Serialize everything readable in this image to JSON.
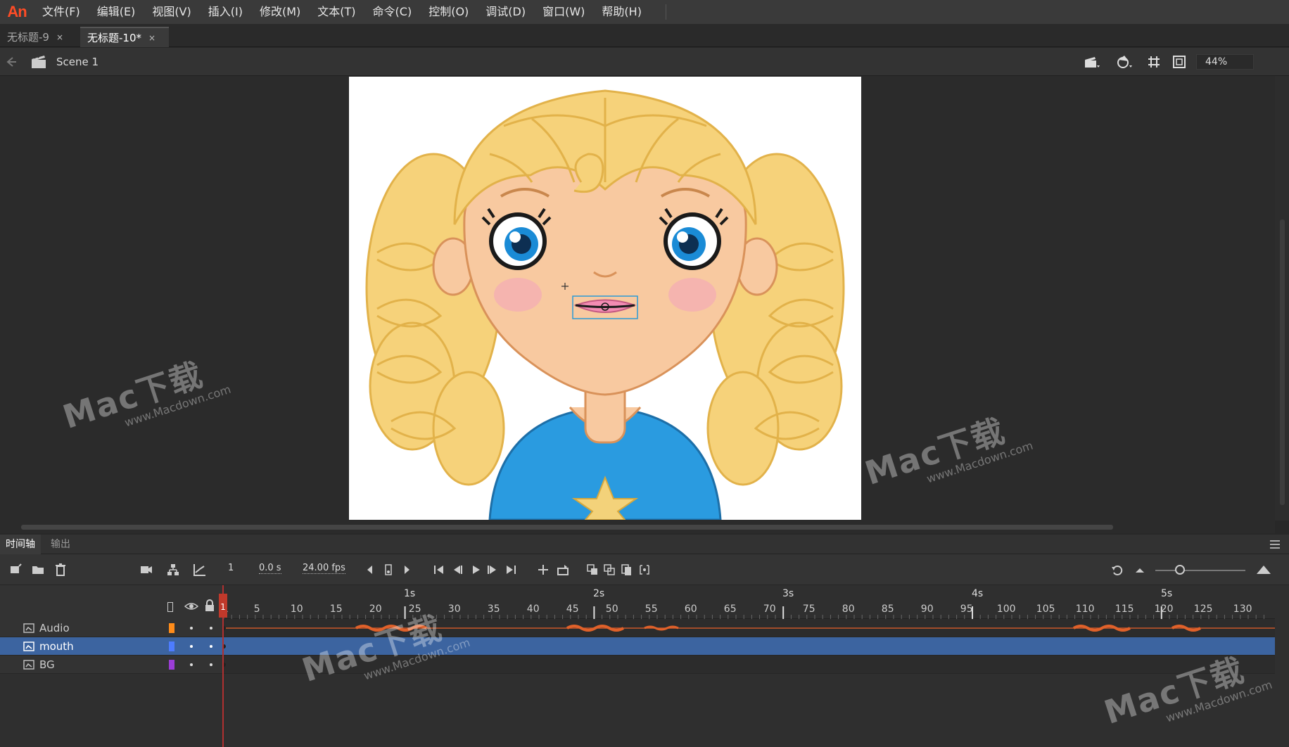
{
  "app": {
    "logo": "An"
  },
  "menu": {
    "items": [
      "文件(F)",
      "编辑(E)",
      "视图(V)",
      "插入(I)",
      "修改(M)",
      "文本(T)",
      "命令(C)",
      "控制(O)",
      "调试(D)",
      "窗口(W)",
      "帮助(H)"
    ]
  },
  "tabs": [
    {
      "label": "无标题-9",
      "close": "×",
      "active": false
    },
    {
      "label": "无标题-10*",
      "close": "×",
      "active": true
    }
  ],
  "editbar": {
    "scene": "Scene 1",
    "zoom": "44%"
  },
  "panel_tabs": {
    "timeline": "时间轴",
    "output": "输出"
  },
  "timeline_toolbar": {
    "frame": "1",
    "time": "0.0 s",
    "fps": "24.00 fps"
  },
  "ruler": {
    "seconds": [
      "1s",
      "2s",
      "3s",
      "4s",
      "5s"
    ],
    "frames": [
      "1",
      "5",
      "10",
      "15",
      "20",
      "25",
      "30",
      "35",
      "40",
      "45",
      "50",
      "55",
      "60",
      "65",
      "70",
      "75",
      "80",
      "85",
      "90",
      "95",
      "100",
      "105",
      "110",
      "115",
      "120",
      "125",
      "130"
    ]
  },
  "layers": [
    {
      "name": "Audio",
      "color": "#ff8c1a",
      "selected": false
    },
    {
      "name": "mouth",
      "color": "#4d7cff",
      "selected": true
    },
    {
      "name": "BG",
      "color": "#9b3dd6",
      "selected": false
    }
  ],
  "watermark": {
    "brand": "Mac下载",
    "url": "www.Macdown.com"
  },
  "colors": {
    "menubar": "#3a3a3a",
    "stage": "#2b2b2b",
    "selected_layer": "#3c64a0",
    "playhead": "#b03030",
    "hair": "#f6d27a",
    "skin": "#f8c9a0",
    "shirt": "#2a9be0"
  }
}
